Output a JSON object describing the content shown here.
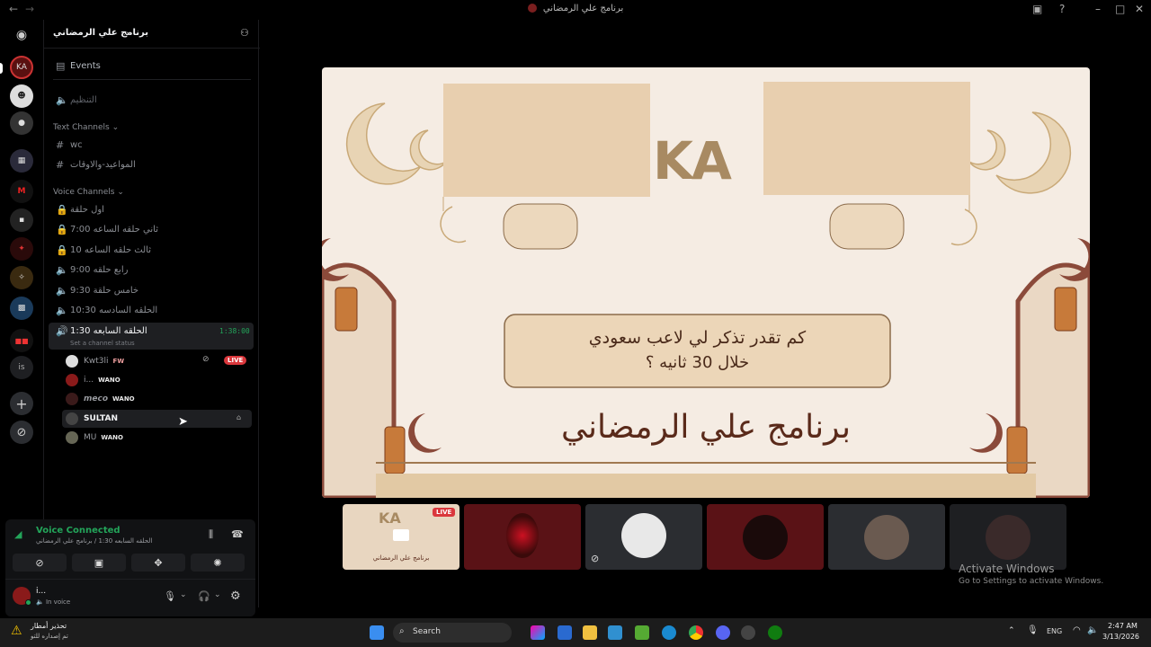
{
  "window": {
    "title": "برنامج علي الرمضاني"
  },
  "server": {
    "name": "برنامج علي الرمضاني",
    "events_label": "Events",
    "organize_channel": "التنظيم",
    "text_category": "Text Channels",
    "text_channels": [
      "wc",
      "المواعيد-والاوقات"
    ],
    "voice_category": "Voice Channels",
    "voice_channels": [
      "اول حلقة",
      "ثاني حلقه الساعه 7:00",
      "ثالث حلقه الساعه 10",
      "رابع حلقه 9:00",
      "خامس حلقة 9:30",
      "الحلقه السادسه 10:30"
    ],
    "active_channel": {
      "name": "الحلقه السابعه 1:30",
      "timer": "1:38:00",
      "status": "Set a channel status"
    },
    "members": [
      {
        "name": "Kwt3li",
        "tag": "FW",
        "live": "LIVE"
      },
      {
        "name": "i...",
        "tag": "WANO"
      },
      {
        "name": "𝙢𝙚𝙘𝙤",
        "tag": "WANO"
      },
      {
        "name": "SULTAN",
        "tag": ""
      },
      {
        "name": "MU",
        "tag": "WANO"
      }
    ]
  },
  "voice_panel": {
    "status": "Voice Connected",
    "location": "الحلقه السابعه 1:30 / برنامج علي الرمضاني",
    "user_name": "i...",
    "user_status": "In voice"
  },
  "stage": {
    "logo": "KA",
    "question_line1": "كم تقدر تذكر لي لاعب سعودي",
    "question_line2": "خلال 30 ثانيه ؟",
    "show_title": "برنامج علي الرمضاني"
  },
  "streams": {
    "live_badge": "LIVE",
    "thumb_title": "برنامج علي الرمضاني"
  },
  "watermark": {
    "line1": "Activate Windows",
    "line2": "Go to Settings to activate Windows."
  },
  "taskbar": {
    "weather_title": "تحذير أمطار",
    "weather_sub": "تم إصداره للتو",
    "search": "Search",
    "lang": "ENG",
    "time": "2:47 AM",
    "date": "3/13/2026"
  },
  "colors": {
    "accent_green": "#23a55a",
    "live_red": "#da373c",
    "stage_bg": "#f5ece3",
    "frame_brown": "#8b4a3a"
  }
}
